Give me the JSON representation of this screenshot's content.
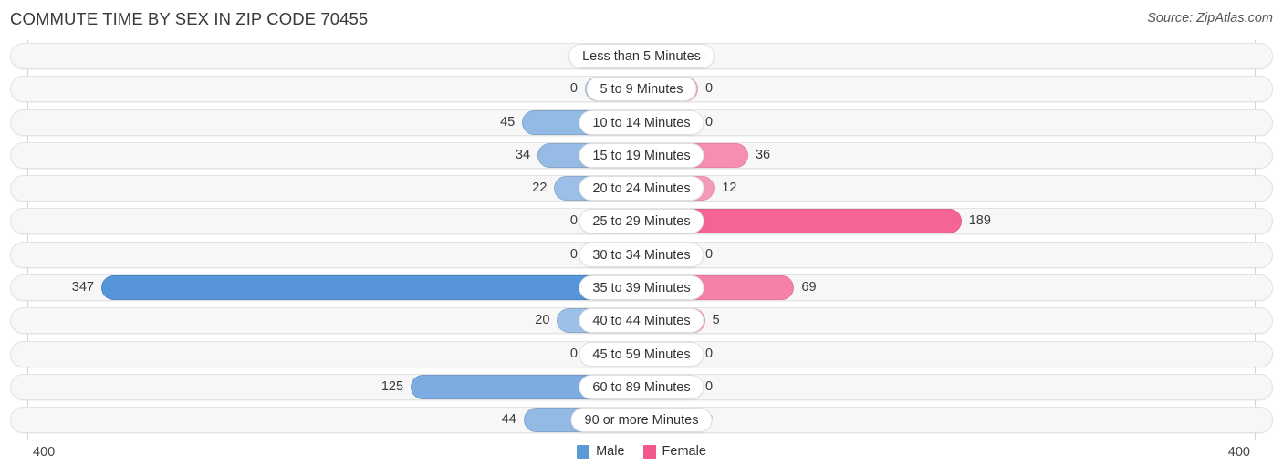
{
  "header": {
    "title": "COMMUTE TIME BY SEX IN ZIP CODE 70455",
    "source": "Source: ZipAtlas.com"
  },
  "legend": {
    "male_label": "Male",
    "female_label": "Female",
    "male_color": "#5b9bd5",
    "female_color": "#f4578c"
  },
  "axis": {
    "left_tick": "400",
    "right_tick": "400",
    "max": 400
  },
  "chart_data": {
    "type": "bar",
    "orientation": "horizontal-diverging",
    "title": "COMMUTE TIME BY SEX IN ZIP CODE 70455",
    "xlabel": "",
    "ylabel": "",
    "xlim": [
      400,
      400
    ],
    "grid": false,
    "legend_position": "bottom-center",
    "categories": [
      "Less than 5 Minutes",
      "5 to 9 Minutes",
      "10 to 14 Minutes",
      "15 to 19 Minutes",
      "20 to 24 Minutes",
      "25 to 29 Minutes",
      "30 to 34 Minutes",
      "35 to 39 Minutes",
      "40 to 44 Minutes",
      "45 to 59 Minutes",
      "60 to 89 Minutes",
      "90 or more Minutes"
    ],
    "series": [
      {
        "name": "Male",
        "values": [
          0,
          0,
          45,
          34,
          22,
          0,
          0,
          347,
          20,
          0,
          125,
          44
        ]
      },
      {
        "name": "Female",
        "values": [
          0,
          0,
          0,
          36,
          12,
          189,
          0,
          69,
          5,
          0,
          0,
          0
        ]
      }
    ]
  },
  "rows": [
    {
      "label": "Less than 5 Minutes",
      "male": "0",
      "female": "0",
      "male_val": 0,
      "female_val": 0
    },
    {
      "label": "5 to 9 Minutes",
      "male": "0",
      "female": "0",
      "male_val": 0,
      "female_val": 0
    },
    {
      "label": "10 to 14 Minutes",
      "male": "45",
      "female": "0",
      "male_val": 45,
      "female_val": 0
    },
    {
      "label": "15 to 19 Minutes",
      "male": "34",
      "female": "36",
      "male_val": 34,
      "female_val": 36
    },
    {
      "label": "20 to 24 Minutes",
      "male": "22",
      "female": "12",
      "male_val": 22,
      "female_val": 12
    },
    {
      "label": "25 to 29 Minutes",
      "male": "0",
      "female": "189",
      "male_val": 0,
      "female_val": 189
    },
    {
      "label": "30 to 34 Minutes",
      "male": "0",
      "female": "0",
      "male_val": 0,
      "female_val": 0
    },
    {
      "label": "35 to 39 Minutes",
      "male": "347",
      "female": "69",
      "male_val": 347,
      "female_val": 69
    },
    {
      "label": "40 to 44 Minutes",
      "male": "20",
      "female": "5",
      "male_val": 20,
      "female_val": 5
    },
    {
      "label": "45 to 59 Minutes",
      "male": "0",
      "female": "0",
      "male_val": 0,
      "female_val": 0
    },
    {
      "label": "60 to 89 Minutes",
      "male": "125",
      "female": "0",
      "male_val": 125,
      "female_val": 0
    },
    {
      "label": "90 or more Minutes",
      "male": "44",
      "female": "0",
      "male_val": 44,
      "female_val": 0
    }
  ]
}
